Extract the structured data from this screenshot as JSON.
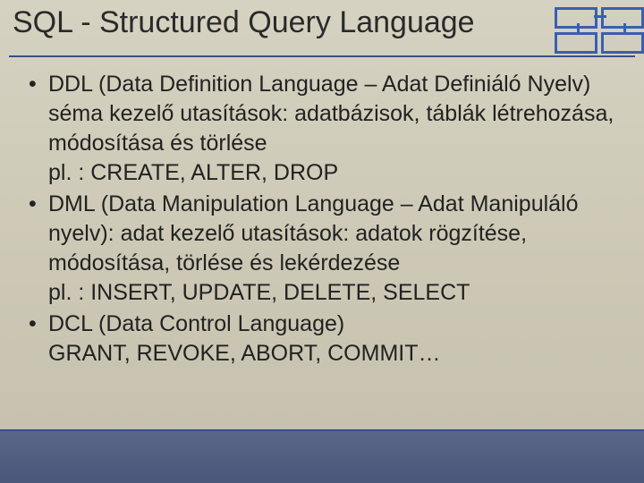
{
  "slide": {
    "title": "SQL - Structured Query Language",
    "bullets": [
      {
        "text": "DDL (Data Definition Language – Adat Definiáló Nyelv) séma kezelő utasítások: adatbázisok, táblák létrehozása, módosítása és törlése",
        "example": "pl. : CREATE, ALTER, DROP"
      },
      {
        "text": "DML (Data Manipulation Language – Adat Manipuláló nyelv): adat kezelő utasítások: adatok rögzítése, módosítása, törlése és lekérdezése",
        "example": "pl. : INSERT, UPDATE, DELETE, SELECT"
      },
      {
        "text": "DCL (Data Control Language)",
        "example": "GRANT, REVOKE, ABORT, COMMIT…"
      }
    ]
  }
}
